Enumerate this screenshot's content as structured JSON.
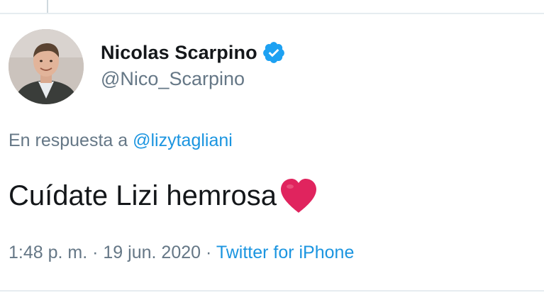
{
  "tweet": {
    "author": {
      "display_name": "Nicolas Scarpino",
      "handle": "@Nico_Scarpino",
      "verified": true,
      "avatar_icon": "profile-photo"
    },
    "reply_prefix": "En respuesta a",
    "reply_to": "@lizytagliani",
    "text": "Cuídate Lizi hemrosa",
    "emoji": "heart-icon",
    "time": "1:48 p. m.",
    "separator": "·",
    "date": "19 jun. 2020",
    "source": "Twitter for iPhone"
  },
  "colors": {
    "link_blue": "#1b95e0",
    "muted_gray": "#657786",
    "text_dark": "#14171a",
    "verified_blue": "#1da1f2",
    "heart_red": "#e0245e"
  }
}
